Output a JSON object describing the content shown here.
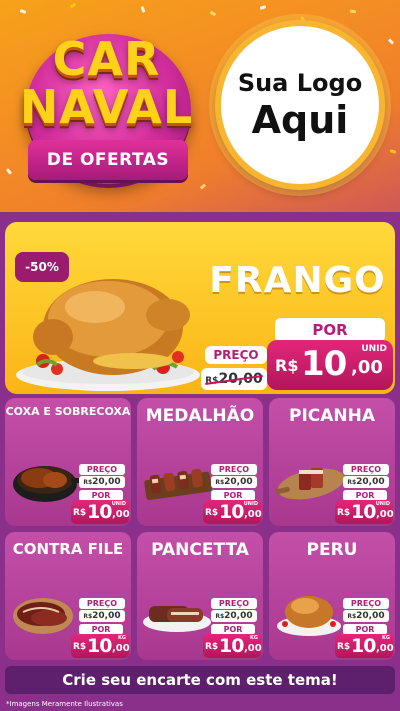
{
  "header": {
    "brand_line1": "CAR",
    "brand_line2": "NAVAL",
    "brand_ribbon": "DE OFERTAS",
    "logo_line1": "Sua Logo",
    "logo_line2": "Aqui"
  },
  "hero": {
    "discount": "-50%",
    "name": "FRANGO",
    "preco_label": "PREÇO",
    "old_price_currency": "R$",
    "old_price_value": "20,00",
    "por_label": "POR",
    "unit": "UNID",
    "new_price_currency": "R$",
    "new_price_int": "10",
    "new_price_cents": ",00"
  },
  "products": [
    {
      "name": "COXA E SOBRECOXA",
      "preco_label": "PREÇO",
      "old_currency": "R$",
      "old_value": "20,00",
      "por_label": "POR",
      "unit": "UNID",
      "currency": "R$",
      "price_int": "10",
      "price_cents": ",00"
    },
    {
      "name": "MEDALHÃO",
      "preco_label": "PREÇO",
      "old_currency": "R$",
      "old_value": "20,00",
      "por_label": "POR",
      "unit": "UNID",
      "currency": "R$",
      "price_int": "10",
      "price_cents": ",00"
    },
    {
      "name": "PICANHA",
      "preco_label": "PREÇO",
      "old_currency": "R$",
      "old_value": "20,00",
      "por_label": "POR",
      "unit": "UNID",
      "currency": "R$",
      "price_int": "10",
      "price_cents": ",00"
    },
    {
      "name": "CONTRA FILE",
      "preco_label": "PREÇO",
      "old_currency": "R$",
      "old_value": "20,00",
      "por_label": "POR",
      "unit": "KG",
      "currency": "R$",
      "price_int": "10",
      "price_cents": ",00"
    },
    {
      "name": "PANCETTA",
      "preco_label": "PREÇO",
      "old_currency": "R$",
      "old_value": "20,00",
      "por_label": "POR",
      "unit": "KG",
      "currency": "R$",
      "price_int": "10",
      "price_cents": ",00"
    },
    {
      "name": "PERU",
      "preco_label": "PREÇO",
      "old_currency": "R$",
      "old_value": "20,00",
      "por_label": "POR",
      "unit": "KG",
      "currency": "R$",
      "price_int": "10",
      "price_cents": ",00"
    }
  ],
  "footer": {
    "cta": "Crie seu encarte com este tema!",
    "disclaimer": "*Imagens Meramente Ilustrativas"
  },
  "colors": {
    "brand_yellow": "#ffd21a",
    "brand_pink": "#d02c9a",
    "hero_yellow": "#fbb416",
    "price_magenta": "#b2165c",
    "card_purple": "#a8388f"
  },
  "icons": {
    "hero": "roast-chicken-icon",
    "p0": "chicken-leg-icon",
    "p1": "skewer-icon",
    "p2": "picanha-steak-icon",
    "p3": "beef-steak-icon",
    "p4": "pancetta-icon",
    "p5": "turkey-icon"
  }
}
